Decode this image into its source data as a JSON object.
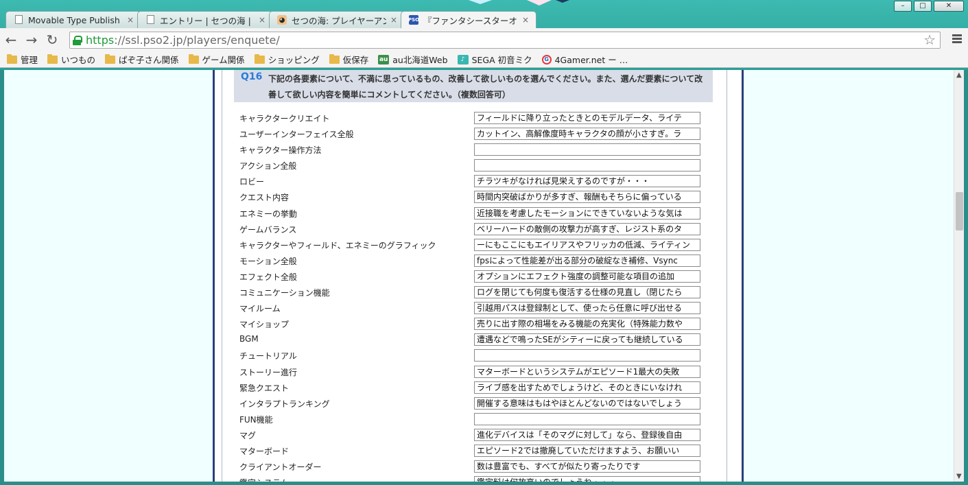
{
  "window": {
    "minimize_glyph": "–",
    "maximize_glyph": "□",
    "close_glyph": "✕"
  },
  "tabs": [
    {
      "label": "Movable Type Publish",
      "icon": "page-icon"
    },
    {
      "label": "エントリー | セつの海 | M",
      "icon": "page-icon"
    },
    {
      "label": "セつの海: プレイヤーアンケ",
      "icon": "cat-icon"
    },
    {
      "label": "『ファンタシースターオンラ",
      "icon": "pso2-icon",
      "active": true
    }
  ],
  "tab_close_glyph": "×",
  "toolbar": {
    "back_glyph": "←",
    "forward_glyph": "→",
    "reload_glyph": "↻",
    "url_scheme": "https",
    "url_rest": "://ssl.pso2.jp/players/enquete/",
    "star_glyph": "☆"
  },
  "bookmarks": [
    {
      "label": "管理",
      "icon": "folder-icon"
    },
    {
      "label": "いつもの",
      "icon": "folder-icon"
    },
    {
      "label": "ぱぞ子さん関係",
      "icon": "folder-icon"
    },
    {
      "label": "ゲーム関係",
      "icon": "folder-icon"
    },
    {
      "label": "ショッピング",
      "icon": "folder-icon"
    },
    {
      "label": "仮保存",
      "icon": "folder-icon"
    },
    {
      "label": "au北海道Web",
      "icon": "au-icon"
    },
    {
      "label": "SEGA 初音ミク",
      "icon": "miku-icon"
    },
    {
      "label": "4Gamer.net ー …",
      "icon": "4gamer-icon"
    }
  ],
  "question": {
    "number": "Q16",
    "text": "下記の各要素について、不満に思っているもの、改善して欲しいものを選んでください。また、選んだ要素について改善して欲しい内容を簡単にコメントしてください。（複数回答可）"
  },
  "rows": [
    {
      "label": "キャラクタークリエイト",
      "value": "フィールドに降り立ったときとのモデルデータ、ライテ"
    },
    {
      "label": "ユーザーインターフェイス全般",
      "value": "カットイン、高解像度時キャラクタの顔が小さすぎ。ラ"
    },
    {
      "label": "キャラクター操作方法",
      "value": ""
    },
    {
      "label": "アクション全般",
      "value": ""
    },
    {
      "label": "ロビー",
      "value": "チラツキがなければ見栄えするのですが・・・"
    },
    {
      "label": "クエスト内容",
      "value": "時間内突破ばかりが多すぎ、報酬もそちらに偏っている"
    },
    {
      "label": "エネミーの挙動",
      "value": "近接職を考慮したモーションにできていないような気は"
    },
    {
      "label": "ゲームバランス",
      "value": "ベリーハードの敵側の攻撃力が高すぎ、レジスト系のタ"
    },
    {
      "label": "キャラクターやフィールド、エネミーのグラフィック",
      "value": "ーにもここにもエイリアスやフリッカの低減、ライティン"
    },
    {
      "label": "モーション全般",
      "value": "fpsによって性能差が出る部分の破綻なき補修、Vsync"
    },
    {
      "label": "エフェクト全般",
      "value": "オプションにエフェクト強度の調整可能な項目の追加"
    },
    {
      "label": "コミュニケーション機能",
      "value": "ログを閉じても何度も復活する仕様の見直し（閉じたら"
    },
    {
      "label": "マイルーム",
      "value": "引越用パスは登録制として、使ったら任意に呼び出せる"
    },
    {
      "label": "マイショップ",
      "value": "売りに出す際の相場をみる機能の充実化（特殊能力数や"
    },
    {
      "label": "BGM",
      "value": "遭遇などで鳴ったSEがシティーに戻っても継続している"
    },
    {
      "label": "チュートリアル",
      "value": ""
    },
    {
      "label": "ストーリー進行",
      "value": "マターボードというシステムがエピソード1最大の失敗"
    },
    {
      "label": "緊急クエスト",
      "value": "ライブ感を出すためでしょうけど、そのときにいなけれ"
    },
    {
      "label": "インタラプトランキング",
      "value": "開催する意味はもはやほとんどないのではないでしょう"
    },
    {
      "label": "FUN機能",
      "value": ""
    },
    {
      "label": "マグ",
      "value": "進化デバイスは「そのマグに対して」なら、登録後自由"
    },
    {
      "label": "マターボード",
      "value": "エピソード2では撤廃していただけますよう、お願いい"
    },
    {
      "label": "クライアントオーダー",
      "value": "数は豊富でも、すべてが似たり寄ったりです"
    },
    {
      "label": "鑑定システム",
      "value": "鑑定料は何故高いのでしょうね・・・"
    }
  ],
  "scrollbar": {
    "up_glyph": "▲",
    "down_glyph": "▼",
    "position": 0.34
  }
}
